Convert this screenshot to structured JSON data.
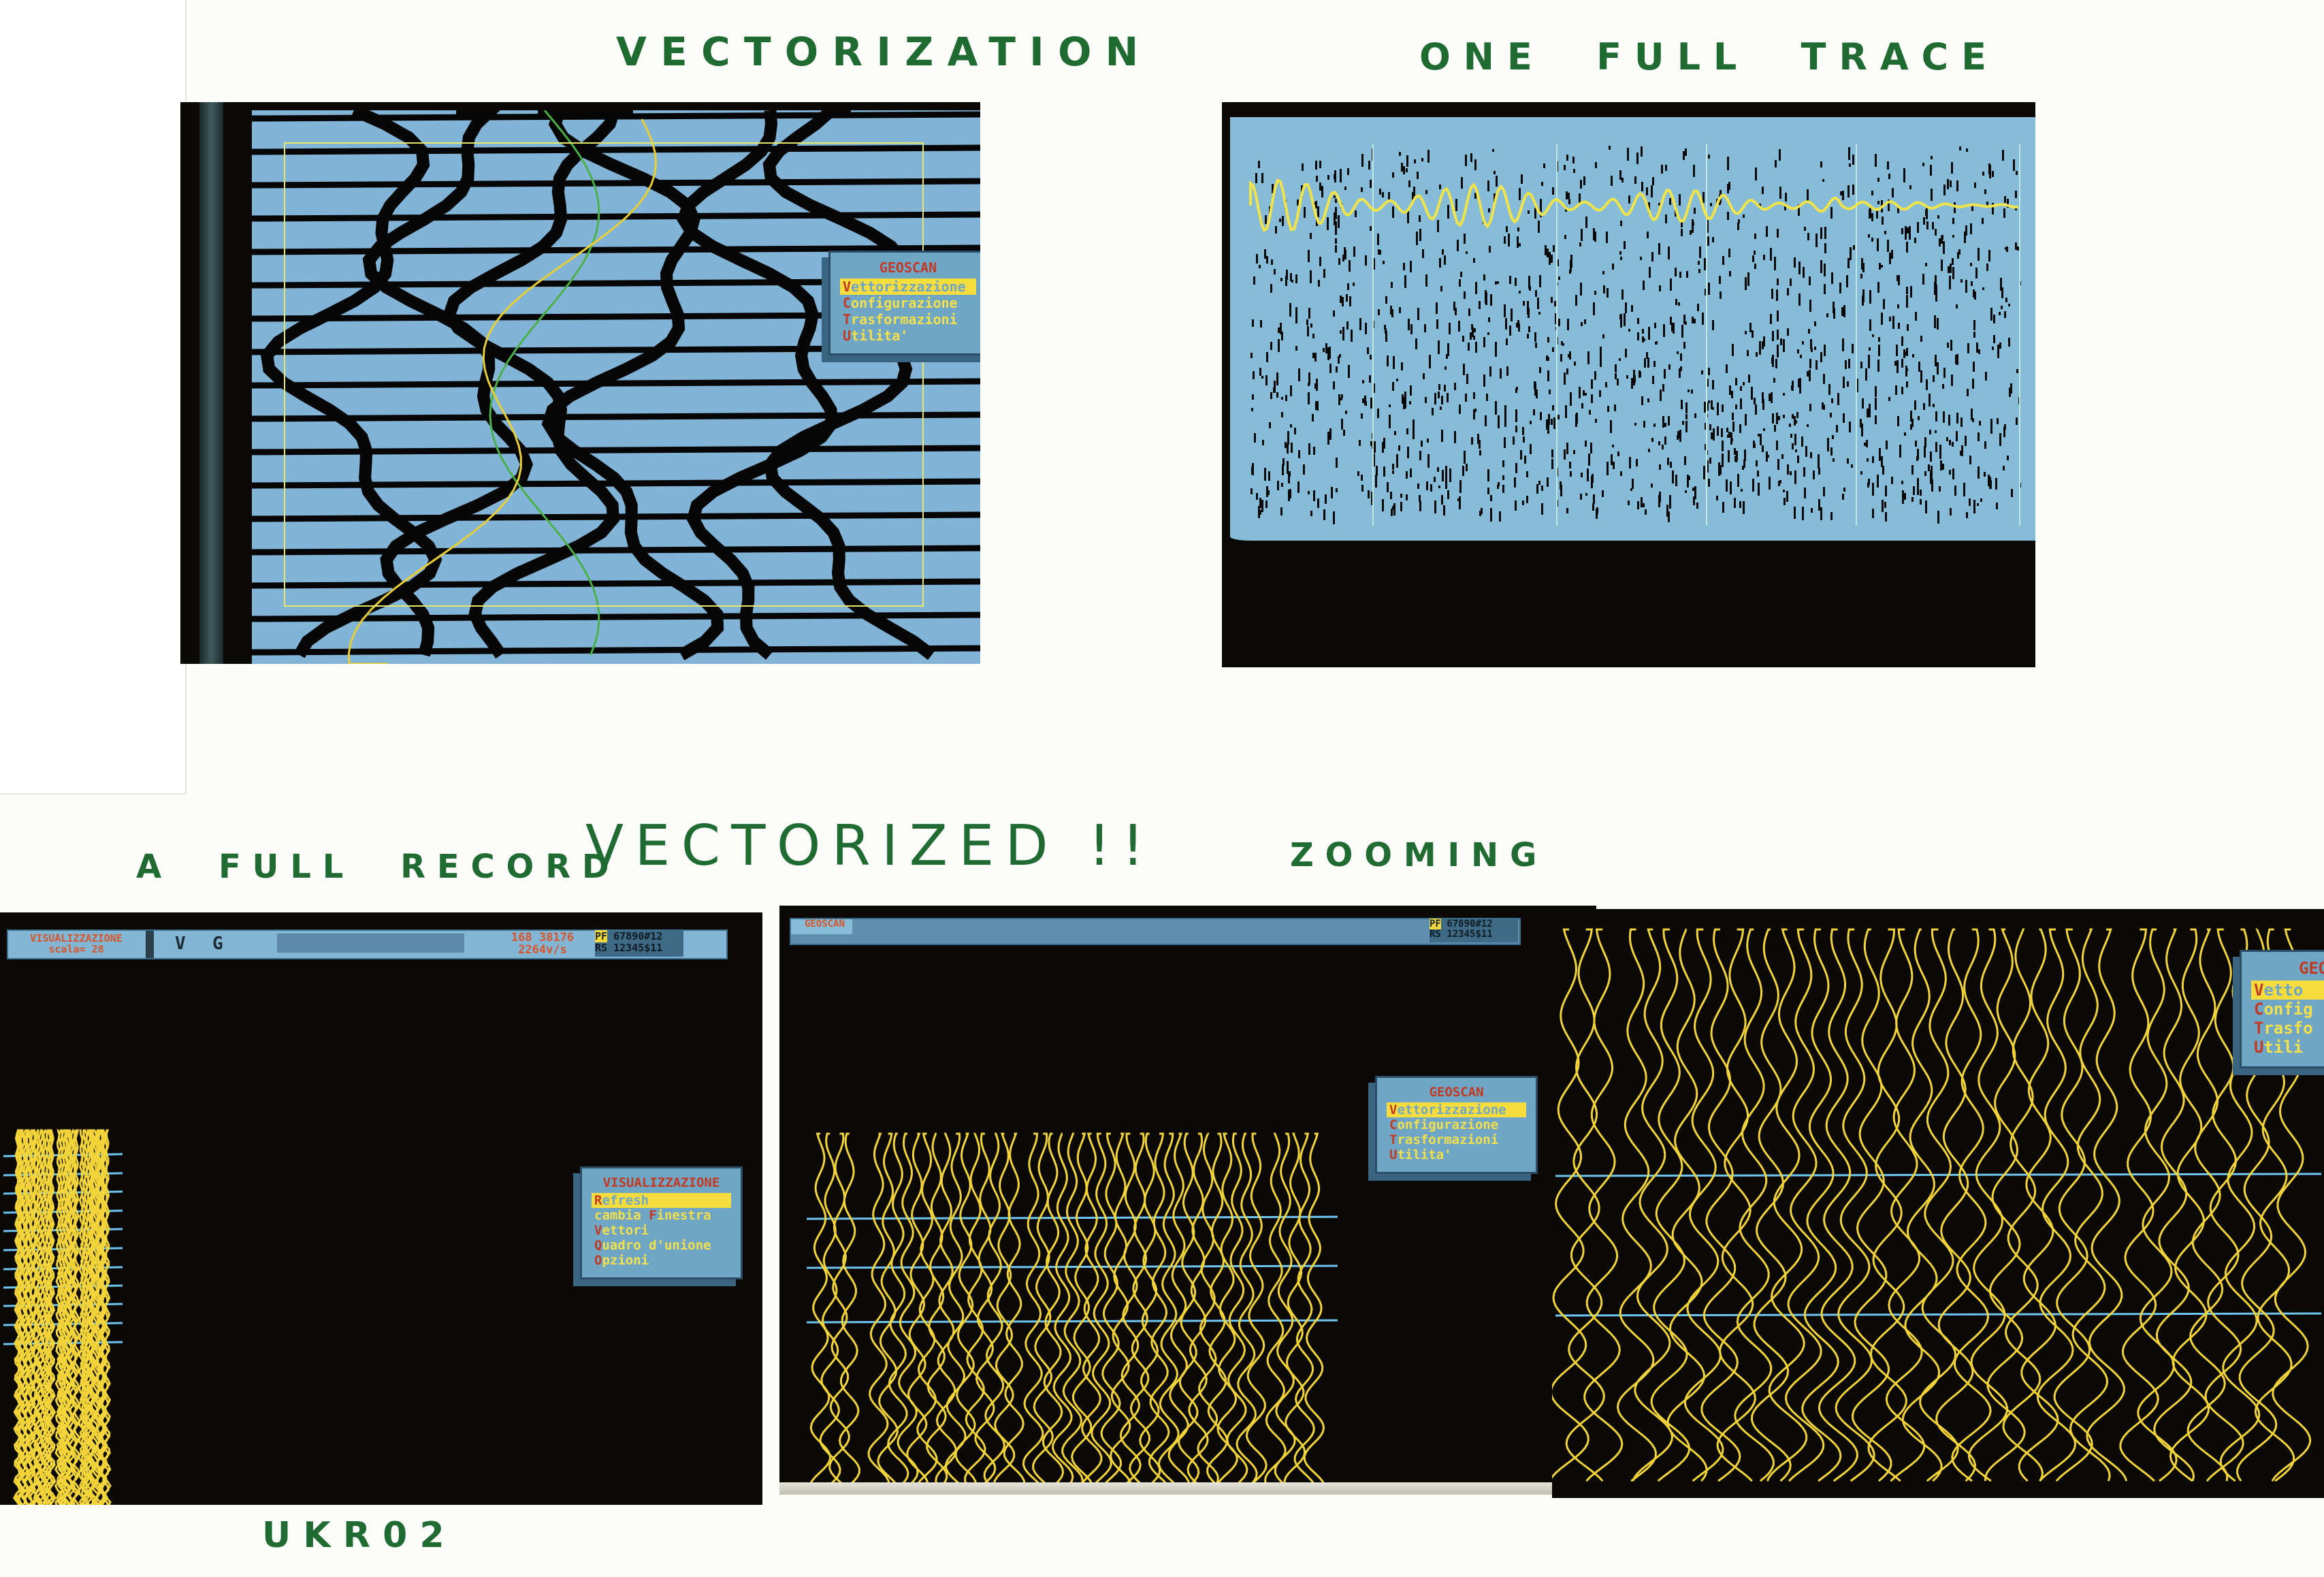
{
  "captions": {
    "vectorization": "VECTORIZATION",
    "one_full_trace": "ONE  FULL  TRACE",
    "a_full_record": "A  FULL  RECORD",
    "vectorized": "VECTORIZED !!",
    "zooming": "ZOOMING",
    "ukr02": "UKR02"
  },
  "colors": {
    "ink_green": "#1f6b32",
    "crt_blue": "#7fb4d8",
    "trace_yellow": "#f2d43a",
    "menu_red": "#c03a24",
    "timing_line_blue": "#6ec6f0"
  },
  "photo1": {
    "menu": {
      "title": "GEOSCAN",
      "items": [
        {
          "hotkey": "V",
          "rest": "ettorizzazione",
          "selected": true
        },
        {
          "hotkey": "C",
          "rest": "onfigurazione",
          "selected": false
        },
        {
          "hotkey": "T",
          "rest": "rasformazioni",
          "selected": false
        },
        {
          "hotkey": "U",
          "rest": "tilita'",
          "selected": false
        }
      ]
    }
  },
  "photo3": {
    "statusbar": {
      "mode": "VISUALIZZAZIONE",
      "scale": "scala= 28",
      "key1": "V",
      "key2": "G",
      "coords": "168  38176",
      "rate": "2264v/s",
      "pf_label": "PF",
      "pf_values": "67890#12",
      "rs_label": "RS",
      "rs_values": "12345$11"
    },
    "menu": {
      "title": "VISUALIZZAZIONE",
      "items": [
        {
          "pre": "",
          "hotkey": "R",
          "rest": "efresh",
          "selected": true
        },
        {
          "pre": "cambia ",
          "hotkey": "F",
          "rest": "inestra",
          "selected": false
        },
        {
          "pre": "",
          "hotkey": "V",
          "rest": "ettori",
          "selected": false
        },
        {
          "pre": "",
          "hotkey": "Q",
          "rest": "uadro d'unione",
          "selected": false
        },
        {
          "pre": "",
          "hotkey": "O",
          "rest": "pzioni",
          "selected": false
        }
      ]
    }
  },
  "photo4": {
    "statusbar": {
      "app": "GEOSCAN",
      "pf_label": "PF",
      "pf_values": "67890#12",
      "rs_label": "RS",
      "rs_values": "12345$11"
    },
    "menu": {
      "title": "GEOSCAN",
      "items": [
        {
          "hotkey": "V",
          "rest": "ettorizzazione",
          "selected": true
        },
        {
          "hotkey": "C",
          "rest": "onfigurazione",
          "selected": false
        },
        {
          "hotkey": "T",
          "rest": "rasformazioni",
          "selected": false
        },
        {
          "hotkey": "U",
          "rest": "tilita'",
          "selected": false
        }
      ]
    }
  },
  "photo5": {
    "menu": {
      "title": "GEO",
      "items": [
        {
          "hotkey": "V",
          "rest": "etto",
          "selected": true
        },
        {
          "hotkey": "C",
          "rest": "onfig",
          "selected": false
        },
        {
          "hotkey": "T",
          "rest": "rasfo",
          "selected": false
        },
        {
          "hotkey": "U",
          "rest": "tili",
          "selected": false
        }
      ]
    }
  }
}
